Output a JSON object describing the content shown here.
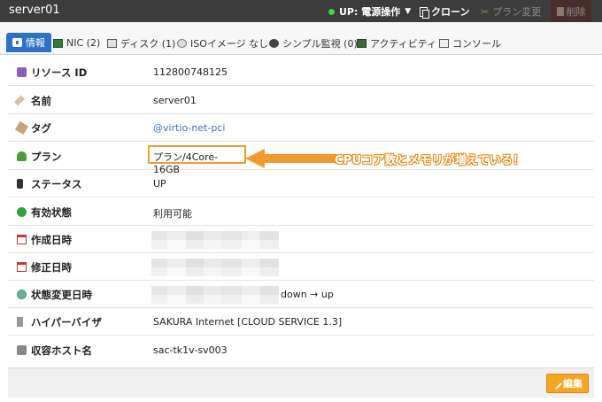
{
  "header": {
    "server_name": "server01",
    "power_label": "UP: 電源操作",
    "clone_label": "クローン",
    "plan_change_label": "プラン変更",
    "delete_label": "削除"
  },
  "tabs": [
    {
      "label": "情報",
      "active": true,
      "icon": "info-icon"
    },
    {
      "label": "NIC (2)",
      "icon": "nic-icon"
    },
    {
      "label": "ディスク (1)",
      "icon": "disk-icon"
    },
    {
      "label": "ISOイメージ なし",
      "icon": "cd-icon"
    },
    {
      "label": "シンプル監視 (0)",
      "icon": "monitor-icon"
    },
    {
      "label": "アクティビティ",
      "icon": "activity-icon"
    },
    {
      "label": "コンソール",
      "icon": "console-icon"
    }
  ],
  "details": {
    "resource_id": {
      "label": "リソース ID",
      "value": "112800748125"
    },
    "name": {
      "label": "名前",
      "value": "server01"
    },
    "tag": {
      "label": "タグ",
      "value": "@virtio-net-pci"
    },
    "plan": {
      "label": "プラン",
      "value": "プラン/4Core-16GB"
    },
    "status": {
      "label": "ステータス",
      "value": "UP"
    },
    "availability": {
      "label": "有効状態",
      "value": "利用可能"
    },
    "created": {
      "label": "作成日時",
      "value": ""
    },
    "modified": {
      "label": "修正日時",
      "value": ""
    },
    "state_changed": {
      "label": "状態変更日時",
      "value": "down → up"
    },
    "hypervisor": {
      "label": "ハイパーバイザ",
      "value": "SAKURA Internet [CLOUD SERVICE 1.3]"
    },
    "host": {
      "label": "収容ホスト名",
      "value": "sac-tk1v-sv003"
    }
  },
  "annotation": {
    "text": "CPUコア数とメモリが増えている！",
    "color": "#f29a2e"
  },
  "footer": {
    "edit_label": "編集"
  },
  "colors": {
    "topbar": "#3c3c3c",
    "active_tab": "#2c73c7",
    "status_up": "#3fd64a",
    "edit_button": "#f5a623"
  }
}
